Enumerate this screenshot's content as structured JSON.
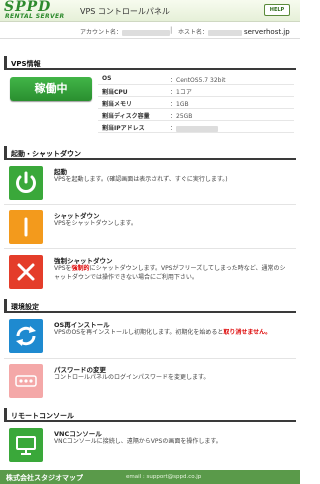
{
  "header": {
    "logo_big": "SPPD",
    "logo_small": "RENTAL SERVER",
    "title": "VPS コントロールパネル",
    "help_label": "HELP"
  },
  "account": {
    "account_label": "アカウント名：",
    "separator": "|",
    "host_label": "ホスト名：",
    "host_value": "serverhost.jp"
  },
  "vps_info": {
    "section_title": "VPS情報",
    "status": "稼働中",
    "rows": [
      {
        "label": "OS",
        "value": "：CentOS5.7 32bit"
      },
      {
        "label": "割当CPU",
        "value": "：1コア"
      },
      {
        "label": "割当メモリ",
        "value": "：1GB"
      },
      {
        "label": "割当ディスク容量",
        "value": "：25GB"
      },
      {
        "label": "割当IPアドレス",
        "value": "："
      }
    ]
  },
  "startup_section": {
    "section_title": "起動・シャットダウン",
    "actions": [
      {
        "title": "起動",
        "desc": "VPSを起動します。(確認画面は表示されず、すぐに実行します。)",
        "color": "#3aa83a",
        "icon": "power-icon"
      },
      {
        "title": "シャットダウン",
        "desc": "VPSをシャットダウンします。",
        "color": "#f39a1c",
        "icon": "shutdown-icon"
      },
      {
        "title": "強制シャットダウン",
        "desc_pre": "VPSを",
        "desc_red": "強制的",
        "desc_post": "にシャットダウンします。VPSがフリーズしてしまった時など、通常のシャットダウンでは操作できない場合にご利用下さい。",
        "color": "#e43d2a",
        "icon": "force-shutdown-icon"
      }
    ]
  },
  "env_section": {
    "section_title": "環境設定",
    "actions": [
      {
        "title": "OS再インストール",
        "desc_pre": "VPSのOSを再インストールし初期化します。初期化を始めると",
        "desc_red": "取り消せません。",
        "color": "#1e8ad0",
        "icon": "reinstall-icon"
      },
      {
        "title": "パスワードの変更",
        "desc": "コントロールパネルのログインパスワードを変更します。",
        "color": "#f4a8a8",
        "icon": "password-icon"
      }
    ]
  },
  "remote_section": {
    "section_title": "リモートコンソール",
    "actions": [
      {
        "title": "VNCコンソール",
        "desc": "VNCコンソールに接続し、遠隔からVPSの画面を操作します。",
        "color": "#3aa83a",
        "icon": "vnc-console-icon"
      }
    ]
  },
  "footer": {
    "company": "株式会社スタジオマップ",
    "email": "email : support@sppd.co.jp"
  }
}
